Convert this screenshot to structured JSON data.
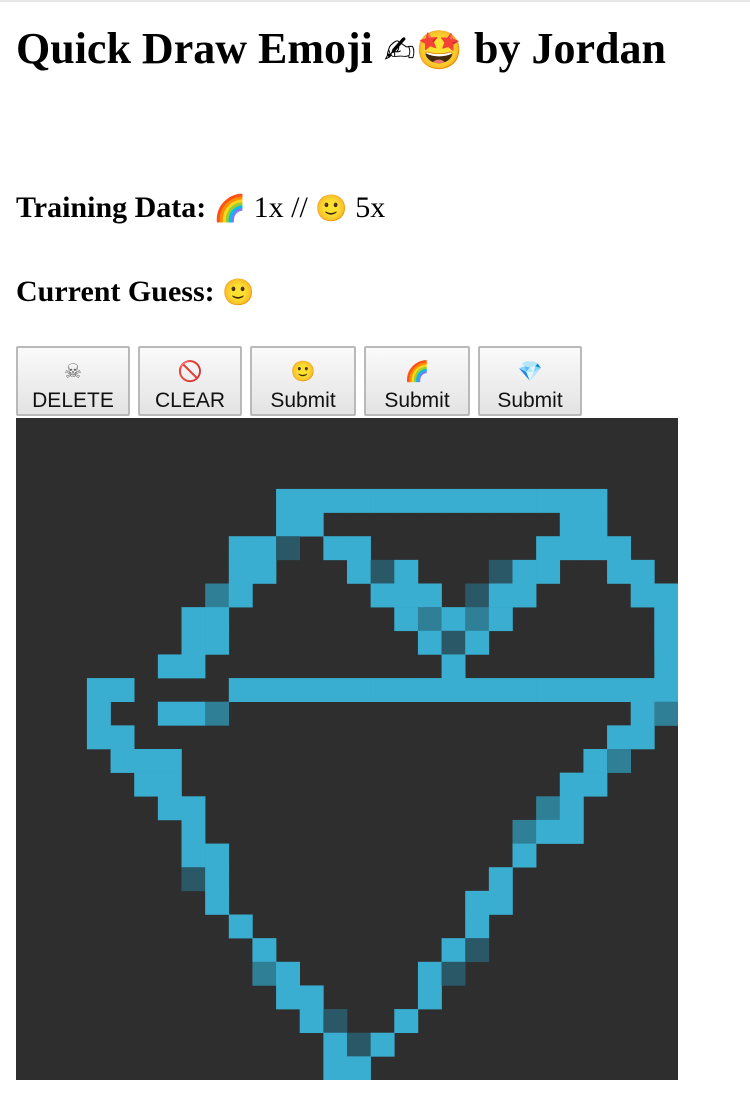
{
  "header": {
    "title_main": "Quick Draw Emoji",
    "title_emojis": "✍🤩",
    "title_by": "by Jordan"
  },
  "training": {
    "label": "Training Data:",
    "rainbow_emoji": "🌈",
    "rainbow_count": "1x",
    "separator": "//",
    "smile_emoji": "🙂",
    "smile_count": "5x"
  },
  "guess": {
    "label": "Current Guess:",
    "emoji": "🙂"
  },
  "toolbar": {
    "buttons": [
      {
        "icon": "☠",
        "icon_name": "skull-icon",
        "label": "DELETE"
      },
      {
        "icon": "🚫",
        "icon_name": "ban-icon",
        "label": "CLEAR"
      },
      {
        "icon": "🙂",
        "icon_name": "smile-icon",
        "label": "Submit"
      },
      {
        "icon": "🌈",
        "icon_name": "rainbow-icon",
        "label": "Submit"
      },
      {
        "icon": "💎",
        "icon_name": "gem-icon",
        "label": "Submit"
      }
    ]
  },
  "canvas": {
    "grid_size": 28,
    "background_color": "#2e2e2e",
    "pixel_color": "#3aaed0",
    "pixel_dim_color": "#2f7f96",
    "pixel_dark_color": "#2a5866",
    "drawing_rows": [
      "",
      "",
      "",
      "",
      "...",
      "...",
      "...",
      "...",
      "...",
      "...",
      "...",
      "...",
      "...",
      "...",
      "...",
      "...",
      "...",
      "...",
      "...",
      "...",
      "...",
      "...",
      "...",
      "...",
      "...",
      "...",
      "...",
      "..."
    ]
  }
}
